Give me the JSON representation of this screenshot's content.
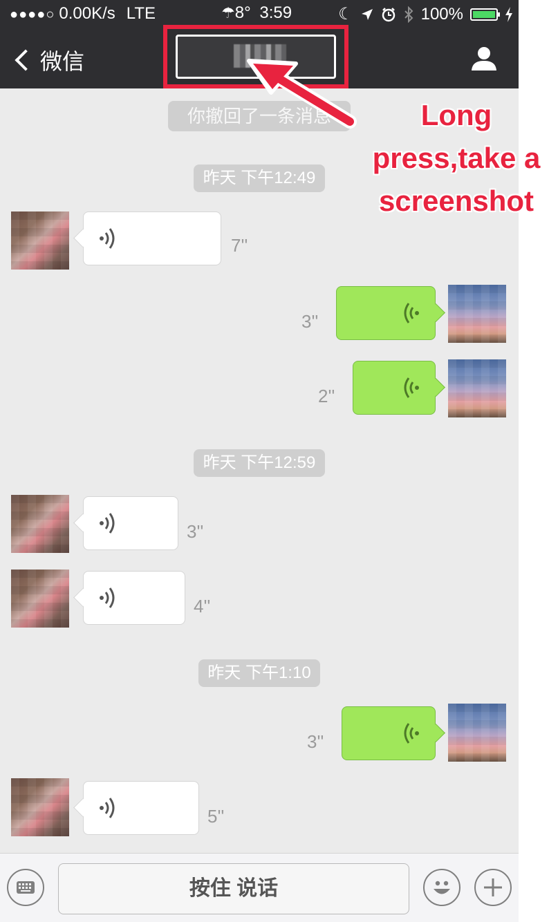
{
  "status_bar": {
    "signal": "●●●●○",
    "network_speed": "0.00K/s",
    "network_type": "LTE",
    "weather_temp": "8°",
    "time": "3:59",
    "battery": "100%"
  },
  "nav": {
    "back_label": "微信",
    "title": ""
  },
  "notice": "你撤回了一条消息",
  "annotation": {
    "text": "Long press,take a screenshot",
    "color": "#e8233f"
  },
  "messages": [
    {
      "type": "timestamp",
      "text": "昨天 下午12:49"
    },
    {
      "type": "voice",
      "side": "in",
      "duration": "7''"
    },
    {
      "type": "voice",
      "side": "out",
      "duration": "3''"
    },
    {
      "type": "voice",
      "side": "out",
      "duration": "2''"
    },
    {
      "type": "timestamp",
      "text": "昨天 下午12:59"
    },
    {
      "type": "voice",
      "side": "in",
      "duration": "3''"
    },
    {
      "type": "voice",
      "side": "in",
      "duration": "4''"
    },
    {
      "type": "timestamp",
      "text": "昨天 下午1:10"
    },
    {
      "type": "voice",
      "side": "out",
      "duration": "3''"
    },
    {
      "type": "voice",
      "side": "in",
      "duration": "5''"
    }
  ],
  "input_bar": {
    "hold_to_talk": "按住 说话",
    "left_icon": "keyboard-icon",
    "emoji_icon": "emoji-icon",
    "plus_icon": "plus-icon"
  },
  "colors": {
    "nav_bg": "#2e2e31",
    "chat_bg": "#ebebeb",
    "outgoing_bubble": "#a0e75a",
    "incoming_bubble": "#ffffff",
    "highlight": "#e8233f"
  }
}
